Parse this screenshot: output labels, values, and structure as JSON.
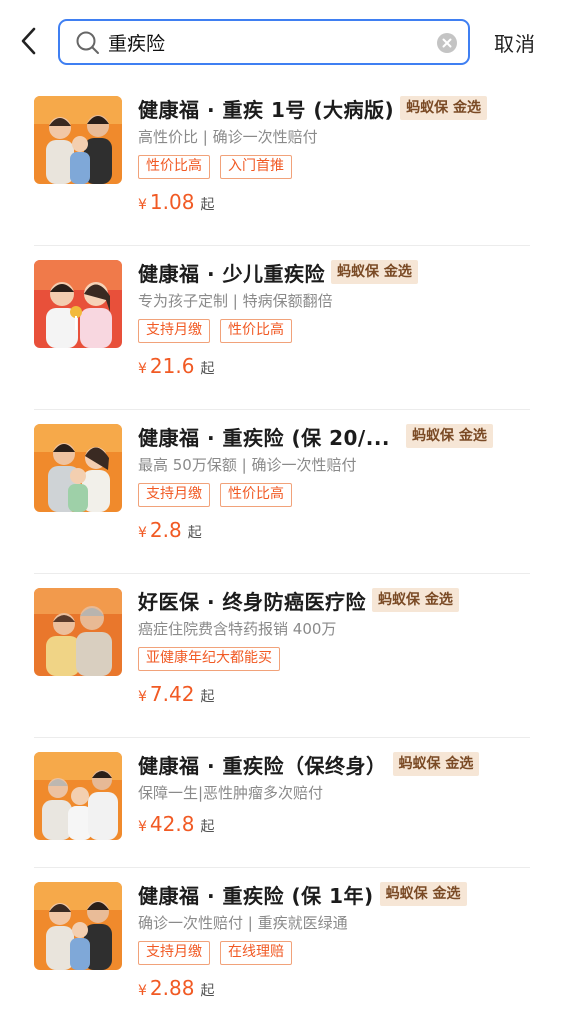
{
  "search": {
    "value": "重疾险",
    "cancel_label": "取消"
  },
  "colors": {
    "accent": "#f15a24",
    "search_border": "#3f7ff2",
    "badge_bg": "#f6e6d6"
  },
  "items": [
    {
      "title": "健康福 · 重疾 1号 (大病版)",
      "badge": "蚂蚁保 金选",
      "desc": "高性价比 | 确诊一次性赔付",
      "tags": [
        "性价比高",
        "入门首推"
      ],
      "currency": "¥",
      "price": "1.08",
      "suffix": "起"
    },
    {
      "title": "健康福 · 少儿重疾险",
      "badge": "蚂蚁保 金选",
      "desc": "专为孩子定制 | 特病保额翻倍",
      "tags": [
        "支持月缴",
        "性价比高"
      ],
      "currency": "¥",
      "price": "21.6",
      "suffix": "起"
    },
    {
      "title": "健康福 · 重疾险 (保 20/...",
      "badge": "蚂蚁保 金选",
      "desc": "最高 50万保额 | 确诊一次性赔付",
      "tags": [
        "支持月缴",
        "性价比高"
      ],
      "currency": "¥",
      "price": "2.8",
      "suffix": "起"
    },
    {
      "title": "好医保 · 终身防癌医疗险",
      "badge": "蚂蚁保 金选",
      "desc": "癌症住院费含特药报销 400万",
      "tags": [
        "亚健康年纪大都能买"
      ],
      "currency": "¥",
      "price": "7.42",
      "suffix": "起"
    },
    {
      "title": "健康福 · 重疾险（保终身）",
      "badge": "蚂蚁保 金选",
      "desc": "保障一生|恶性肿瘤多次赔付",
      "tags": [],
      "currency": "¥",
      "price": "42.8",
      "suffix": "起"
    },
    {
      "title": "健康福 · 重疾险 (保 1年)",
      "badge": "蚂蚁保 金选",
      "desc": "确诊一次性赔付 | 重疾就医绿通",
      "tags": [
        "支持月缴",
        "在线理赔"
      ],
      "currency": "¥",
      "price": "2.88",
      "suffix": "起"
    }
  ]
}
